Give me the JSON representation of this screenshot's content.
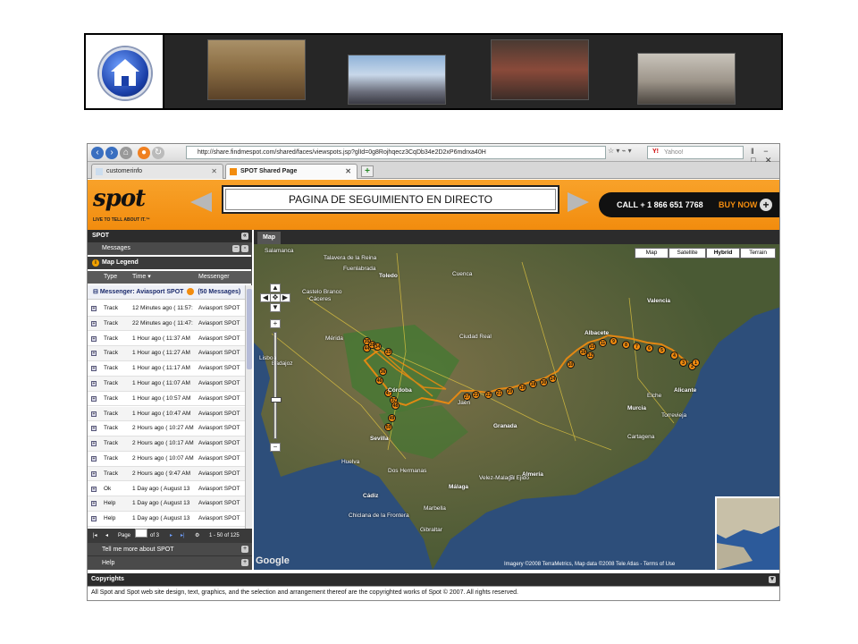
{
  "browser": {
    "address": "http://share.findmespot.com/shared/faces/viewspots.jsp?glId=0g8Rojhqecz3CqDb34e2D2xP6mdrxa40H",
    "search_placeholder": "Yahoo!",
    "search_brand": "Y!",
    "tabs": [
      {
        "label": "customerinfo"
      },
      {
        "label": "SPOT Shared Page"
      }
    ]
  },
  "header": {
    "logo": "spot",
    "tagline": "LIVE TO TELL ABOUT IT.™",
    "title": "PAGINA DE SEGUIMIENTO EN DIRECTO",
    "call": "CALL + 1 866 651 7768",
    "buy": "BUY NOW"
  },
  "panel": {
    "title": "SPOT",
    "messages_label": "Messages",
    "legend_label": "Map Legend",
    "columns": {
      "type": "Type",
      "time": "Time ▾",
      "messenger": "Messenger"
    },
    "messenger_group": "Messenger: Aviasport SPOT",
    "messenger_count": "(50 Messages)",
    "rows": [
      {
        "type": "Track",
        "time": "12 Minutes ago ( 11:57:",
        "messenger": "Aviasport SPOT"
      },
      {
        "type": "Track",
        "time": "22 Minutes ago ( 11:47:",
        "messenger": "Aviasport SPOT"
      },
      {
        "type": "Track",
        "time": "1 Hour ago ( 11:37 AM",
        "messenger": "Aviasport SPOT"
      },
      {
        "type": "Track",
        "time": "1 Hour ago ( 11:27 AM",
        "messenger": "Aviasport SPOT"
      },
      {
        "type": "Track",
        "time": "1 Hour ago ( 11:17 AM",
        "messenger": "Aviasport SPOT"
      },
      {
        "type": "Track",
        "time": "1 Hour ago ( 11:07 AM",
        "messenger": "Aviasport SPOT"
      },
      {
        "type": "Track",
        "time": "1 Hour ago ( 10:57 AM",
        "messenger": "Aviasport SPOT"
      },
      {
        "type": "Track",
        "time": "1 Hour ago ( 10:47 AM",
        "messenger": "Aviasport SPOT"
      },
      {
        "type": "Track",
        "time": "2 Hours ago ( 10:27 AM",
        "messenger": "Aviasport SPOT"
      },
      {
        "type": "Track",
        "time": "2 Hours ago ( 10:17 AM",
        "messenger": "Aviasport SPOT"
      },
      {
        "type": "Track",
        "time": "2 Hours ago ( 10:07 AM",
        "messenger": "Aviasport SPOT"
      },
      {
        "type": "Track",
        "time": "2 Hours ago ( 9:47 AM",
        "messenger": "Aviasport SPOT"
      },
      {
        "type": "Ok",
        "time": "1 Day ago ( August 13",
        "messenger": "Aviasport SPOT"
      },
      {
        "type": "Help",
        "time": "1 Day ago ( August 13",
        "messenger": "Aviasport SPOT"
      },
      {
        "type": "Help",
        "time": "1 Day ago ( August 13",
        "messenger": "Aviasport SPOT"
      }
    ],
    "pager": {
      "page_label": "Page",
      "of_label": "of 3",
      "range": "1 - 50 of 125"
    },
    "tell_more": "Tell me more about SPOT",
    "help": "Help"
  },
  "map": {
    "tab_label": "Map",
    "types": [
      "Map",
      "Satellite",
      "Hybrid",
      "Terrain"
    ],
    "selected_type": "Hybrid",
    "attribution": "Imagery ©2008 TerraMetrics, Map data ©2008 Tele Atlas - Terms of Use",
    "google": "Google",
    "cities": [
      {
        "name": "Salamanca"
      },
      {
        "name": "Talavera de la Reina"
      },
      {
        "name": "Fuenlabrada"
      },
      {
        "name": "Toledo"
      },
      {
        "name": "Cuenca"
      },
      {
        "name": "Castelo Branco"
      },
      {
        "name": "Cáceres"
      },
      {
        "name": "Valencia"
      },
      {
        "name": "Mérida"
      },
      {
        "name": "Badajoz"
      },
      {
        "name": "Ciudad Real"
      },
      {
        "name": "Albacete"
      },
      {
        "name": "Córdoba"
      },
      {
        "name": "Jaén"
      },
      {
        "name": "Sevilla"
      },
      {
        "name": "Granada"
      },
      {
        "name": "Murcia"
      },
      {
        "name": "Alicante"
      },
      {
        "name": "Cartagena"
      },
      {
        "name": "Málaga"
      },
      {
        "name": "Almería"
      },
      {
        "name": "Cádiz"
      },
      {
        "name": "Huelva"
      },
      {
        "name": "Marbella"
      },
      {
        "name": "Lisboa"
      },
      {
        "name": "Elche"
      },
      {
        "name": "Torrevieja"
      },
      {
        "name": "Chiclana de la Frontera"
      },
      {
        "name": "Gibraltar"
      },
      {
        "name": "Velez-Malaga"
      },
      {
        "name": "El Ejido"
      },
      {
        "name": "Dos Hermanas"
      }
    ],
    "markers": [
      "35",
      "44",
      "28",
      "34",
      "33",
      "36",
      "46",
      "47",
      "37",
      "48",
      "49",
      "50",
      "30",
      "24",
      "27",
      "23",
      "22",
      "21",
      "20",
      "19",
      "18",
      "16",
      "15",
      "12",
      "11",
      "9",
      "8",
      "7",
      "6",
      "5",
      "4",
      "3",
      "2",
      "1",
      "10"
    ]
  },
  "footer": {
    "heading": "Copyrights",
    "text": "All Spot and Spot web site design, text, graphics, and the selection and arrangement thereof are the copyrighted works of Spot © 2007. All rights reserved."
  }
}
